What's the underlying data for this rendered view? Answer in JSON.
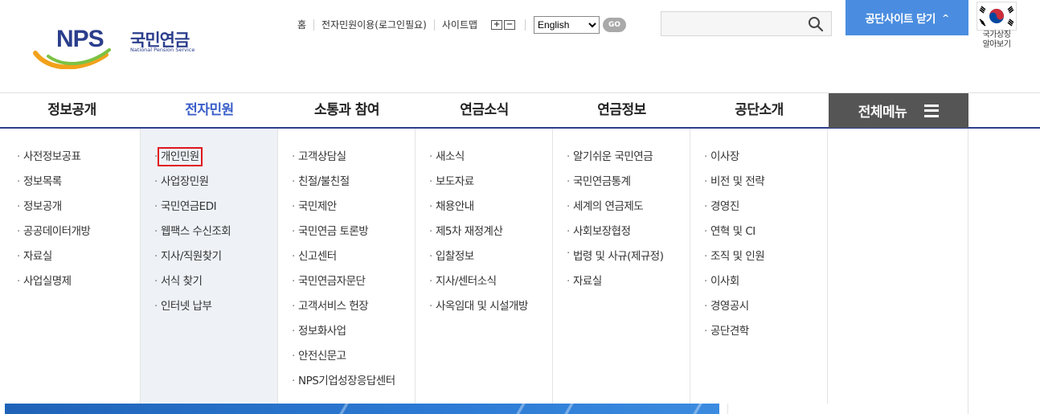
{
  "logo": {
    "mark_text": "NPS",
    "kor": "국민연금",
    "eng": "National Pension Service"
  },
  "util": {
    "links": [
      "홈",
      "전자민원이용(로그인필요)",
      "사이트맵"
    ],
    "zoom_in": "+",
    "zoom_out": "−",
    "language": "English",
    "go_label": "GO"
  },
  "search": {
    "value": "",
    "placeholder": ""
  },
  "close_site": {
    "label": "공단사이트 닫기",
    "icon": "chevron-up-icon"
  },
  "emblem": {
    "line1": "국가상징",
    "line2": "알아보기"
  },
  "gnb": {
    "items": [
      "정보공개",
      "전자민원",
      "소통과 참여",
      "연금소식",
      "연금정보",
      "공단소개"
    ],
    "active_index": 1,
    "allmenu_label": "전체메뉴"
  },
  "menu": {
    "col0": [
      "사전정보공표",
      "정보목록",
      "정보공개",
      "공공데이터개방",
      "자료실",
      "사업실명제"
    ],
    "col1": [
      "개인민원",
      "사업장민원",
      "국민연금EDI",
      "웹팩스 수신조회",
      "지사/직원찾기",
      "서식 찾기",
      "인터넷 납부"
    ],
    "col2": [
      "고객상담실",
      "친절/불친절",
      "국민제안",
      "국민연금 토론방",
      "신고센터",
      "국민연금자문단",
      "고객서비스 헌장",
      "정보화사업",
      "안전신문고",
      "NPS기업성장응답센터"
    ],
    "col3": [
      "새소식",
      "보도자료",
      "채용안내",
      "제5차 재정계산",
      "입찰정보",
      "지사/센터소식",
      "사옥임대 및 시설개방"
    ],
    "col4": [
      "알기쉬운 국민연금",
      "국민연금통계",
      "세계의 연금제도",
      "사회보장협정",
      "법령 및 사규(제규정)",
      "자료실"
    ],
    "col5": [
      "이사장",
      "비전 및 전략",
      "경영진",
      "연혁 및 CI",
      "조직 및 인원",
      "이사회",
      "경영공시",
      "공단견학"
    ]
  },
  "colors": {
    "brand_navy": "#2b3e8c",
    "active_blue": "#3a5ec8",
    "close_button": "#4a8de0",
    "allmenu_bg": "#555555",
    "highlight_red": "#e0141e",
    "active_col_bg": "#eef2f7"
  }
}
